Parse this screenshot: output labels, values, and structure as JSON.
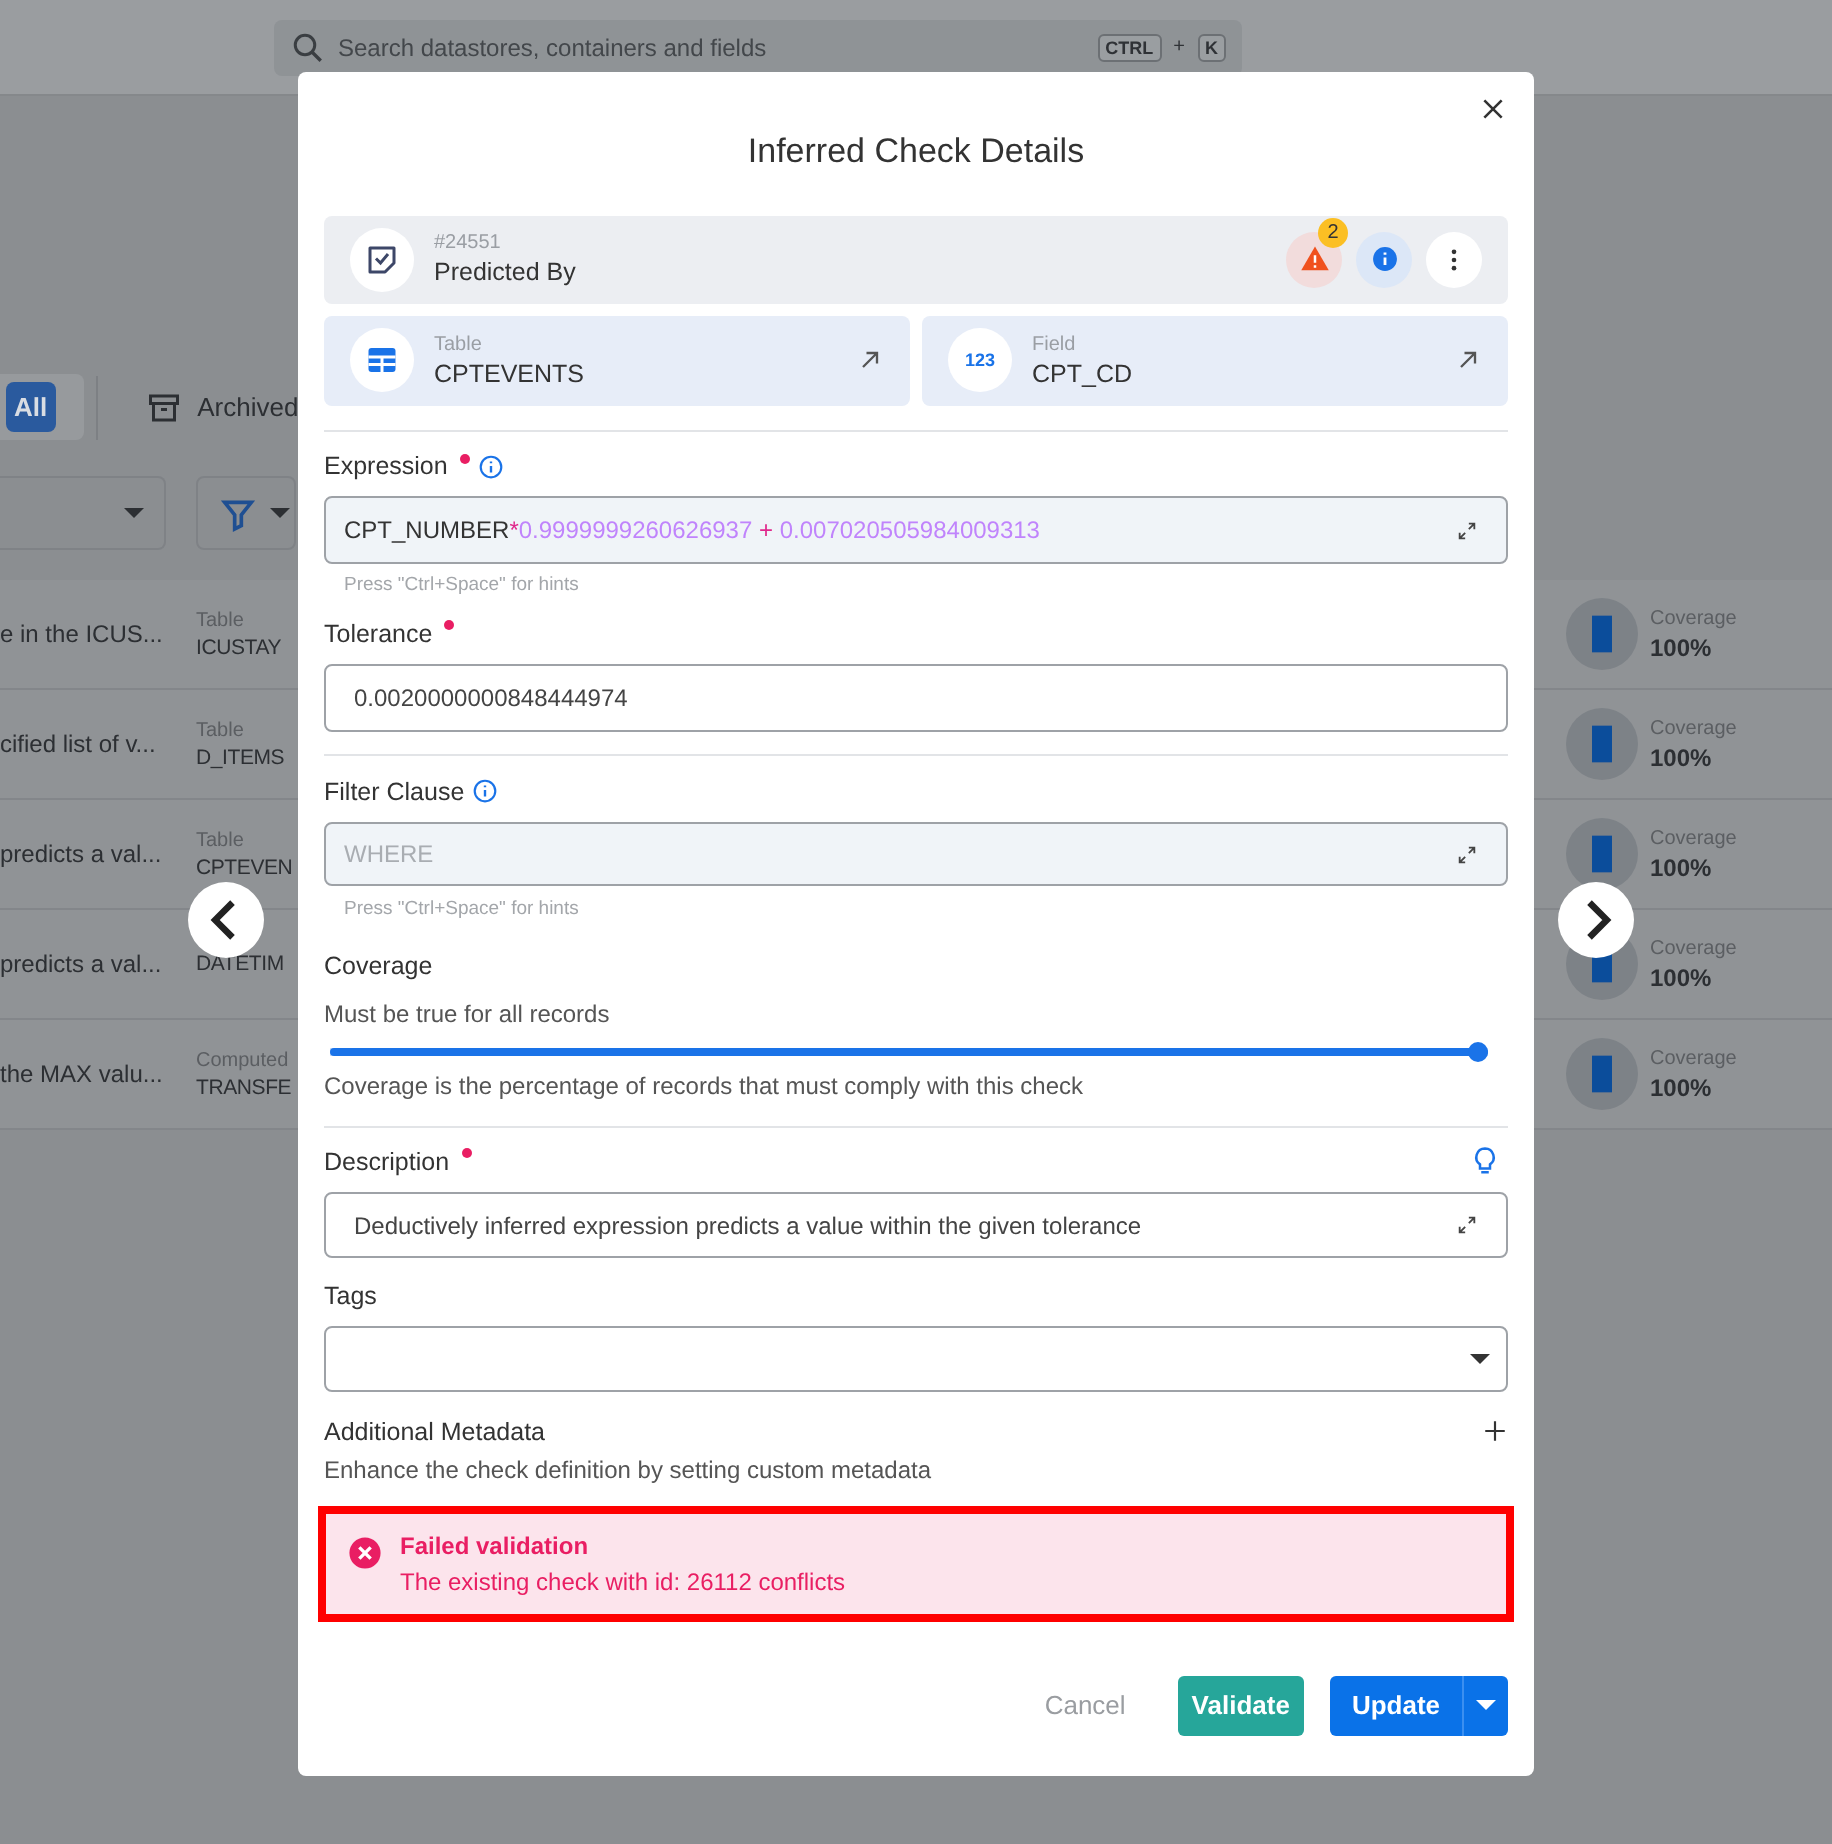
{
  "search": {
    "placeholder": "Search datastores, containers and fields",
    "shortcut": [
      "CTRL",
      "+",
      "K"
    ]
  },
  "filter_tabs": [
    {
      "label": "All",
      "selected": true
    },
    {
      "label": "Archived",
      "selected": false
    }
  ],
  "background_rows": [
    {
      "text": "e in the ICUS...",
      "type_label": "Table",
      "container": "ICUSTAY",
      "coverage_label": "Coverage",
      "coverage": "100%"
    },
    {
      "text": "cified list of v...",
      "type_label": "Table",
      "container": "D_ITEMS",
      "coverage_label": "Coverage",
      "coverage": "100%"
    },
    {
      "text": "predicts a val...",
      "type_label": "Table",
      "container": "CPTEVEN",
      "coverage_label": "Coverage",
      "coverage": "100%"
    },
    {
      "text": "predicts a val...",
      "container": "DATETIM",
      "coverage_label": "Coverage",
      "coverage": "100%"
    },
    {
      "text": "the MAX valu...",
      "type_label": "Computed",
      "container": "TRANSFE",
      "coverage_label": "Coverage",
      "coverage": "100%"
    }
  ],
  "modal": {
    "title": "Inferred Check Details",
    "check": {
      "id": "#24551",
      "rule": "Predicted By",
      "anomaly_count": "2"
    },
    "links": [
      {
        "kind": "table",
        "label": "Table",
        "value": "CPTEVENTS"
      },
      {
        "kind": "field",
        "label": "Field",
        "value": "CPT_CD",
        "icon_text": "123"
      }
    ],
    "expression": {
      "label": "Expression",
      "required": true,
      "tokens": [
        {
          "kind": "identifier",
          "text": "CPT_NUMBER"
        },
        {
          "kind": "operator",
          "text": "*"
        },
        {
          "kind": "number",
          "text": "0.9999999260626937"
        },
        {
          "kind": "operator",
          "text": " + "
        },
        {
          "kind": "number",
          "text": "0.007020505984009313"
        }
      ],
      "hint": "Press \"Ctrl+Space\" for hints"
    },
    "tolerance": {
      "label": "Tolerance",
      "required": true,
      "value": "0.0020000000848444974"
    },
    "filter_clause": {
      "label": "Filter Clause",
      "placeholder": "WHERE",
      "hint": "Press \"Ctrl+Space\" for hints"
    },
    "coverage": {
      "label": "Coverage",
      "caption": "Must be true for all records",
      "level": 1,
      "note": "Coverage is the percentage of records that must comply with this check"
    },
    "description": {
      "label": "Description",
      "required": true,
      "value": "Deductively inferred expression predicts a value within the given tolerance"
    },
    "tags": {
      "label": "Tags"
    },
    "metadata": {
      "label": "Additional Metadata",
      "caption": "Enhance the check definition by setting custom metadata"
    },
    "alert": {
      "title": "Failed validation",
      "message": "The existing check with id: 26112 conflicts",
      "highlighted": true
    },
    "buttons": {
      "cancel": "Cancel",
      "validate": "Validate",
      "update": "Update"
    }
  }
}
